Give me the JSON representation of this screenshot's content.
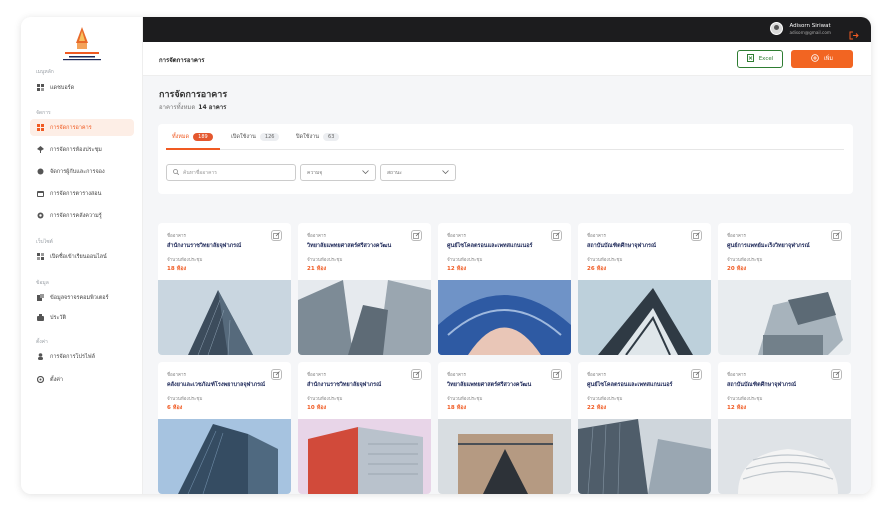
{
  "sidebar": {
    "sections": [
      "เมนูหลัก",
      "จัดการ",
      "เว็บไซต์",
      "ข้อมูล",
      "ตั้งค่า"
    ],
    "items": [
      {
        "label": "แดชบอร์ด",
        "icon": "dashboard-icon"
      },
      {
        "label": "การจัดการอาคาร",
        "icon": "building-grid-icon"
      },
      {
        "label": "การจัดการห้องประชุม",
        "icon": "meeting-room-icon"
      },
      {
        "label": "จัดการผู้กับและการจอง",
        "icon": "booking-icon"
      },
      {
        "label": "การจัดการตารางสอน",
        "icon": "schedule-icon"
      },
      {
        "label": "การจัดการคลังความรู้",
        "icon": "knowledge-icon"
      },
      {
        "label": "เปิดชื่อเข้าเรียนออนไลน์",
        "icon": "online-class-icon"
      },
      {
        "label": "ข้อมูลจราจรคอมพิวเตอร์",
        "icon": "traffic-data-icon"
      },
      {
        "label": "ประวัติ",
        "icon": "history-icon"
      },
      {
        "label": "การจัดการโปรไฟล์",
        "icon": "profile-icon"
      },
      {
        "label": "ตั้งค่า",
        "icon": "settings-icon"
      }
    ]
  },
  "user": {
    "name": "Adisorn Siriwat",
    "email": "adisorn@gmail.com"
  },
  "header": {
    "title": "การจัดการอาคาร",
    "excel_label": "Excel",
    "add_label": "เพิ่ม"
  },
  "page": {
    "title": "การจัดการอาคาร",
    "subtitle": "อาคารทั้งหมด",
    "total": "14 อาคาร"
  },
  "tabs": [
    {
      "label": "ทั้งหมด",
      "count": "189"
    },
    {
      "label": "เปิดใช้งาน",
      "count": "126"
    },
    {
      "label": "ปิดใช้งาน",
      "count": "63"
    }
  ],
  "filters": {
    "search_placeholder": "ค้นหาชื่ออาคาร",
    "type_label": "ความจุ",
    "status_label": "สถานะ"
  },
  "card_labels": {
    "name": "ชื่ออาคาร",
    "capacity": "จำนวนห้องประชุม"
  },
  "cards": [
    {
      "name": "สำนักงานราชวิทยาลัยจุฬาภรณ์",
      "rooms": "18 ห้อง"
    },
    {
      "name": "วิทยาลัยแพทยศาสตร์ศรีสวางควัฒน",
      "rooms": "21 ห้อง"
    },
    {
      "name": "ศูนย์ไซโคลตรอนและเพทสแกนเนอร์",
      "rooms": "12 ห้อง"
    },
    {
      "name": "สถาบันบัณฑิตศึกษาจุฬาภรณ์",
      "rooms": "26 ห้อง"
    },
    {
      "name": "ศูนย์การแพทย์มะเร็งวิทยาจุฬาภรณ์",
      "rooms": "20 ห้อง"
    },
    {
      "name": "คลังยาและเวชภัณฑ์โรงพยาบาลจุฬาภรณ์",
      "rooms": "6 ห้อง"
    },
    {
      "name": "สำนักงานราชวิทยาลัยจุฬาภรณ์",
      "rooms": "10 ห้อง"
    },
    {
      "name": "วิทยาลัยแพทยศาสตร์ศรีสวางควัฒน",
      "rooms": "18 ห้อง"
    },
    {
      "name": "ศูนย์ไซโคลตรอนและเพทสแกนเนอร์",
      "rooms": "22 ห้อง"
    },
    {
      "name": "สถาบันบัณฑิตศึกษาจุฬาภรณ์",
      "rooms": "12 ห้อง"
    }
  ],
  "colors": {
    "accent": "#f05a22",
    "topbar": "#1c1c1e",
    "excel": "#2e7d32",
    "navy": "#1f2a5a"
  }
}
